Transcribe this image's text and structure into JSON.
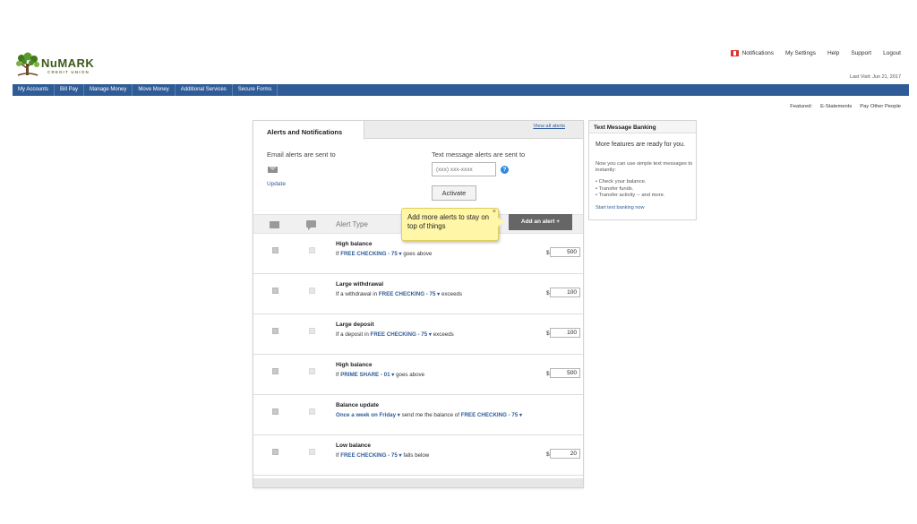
{
  "logo": {
    "name": "NuMARK",
    "subtitle": "CREDIT UNION"
  },
  "top_links": [
    "Notifications",
    "My Settings",
    "Help",
    "Support",
    "Logout"
  ],
  "last_visit": "Last Visit: Jun 21, 2017",
  "nav": [
    "My Accounts",
    "Bill Pay",
    "Manage Money",
    "Move Money",
    "Additional Services",
    "Secure Forms"
  ],
  "featured": {
    "label": "Featured:",
    "items": [
      "E-Statements",
      "Pay Other People"
    ]
  },
  "panel": {
    "tab": "Alerts and Notifications",
    "view_all": "View all alerts",
    "email_label": "Email alerts are sent to",
    "update": "Update",
    "text_label": "Text message alerts are sent to",
    "phone_placeholder": "(xxx) xxx-xxxx",
    "help": "?",
    "activate": "Activate",
    "alert_type_header": "Alert Type",
    "add_alert": "Add an alert  +",
    "tooltip": "Add more alerts to stay on top of things",
    "tooltip_close": "×",
    "currency": "$"
  },
  "alerts": [
    {
      "title": "High balance",
      "pre": "If",
      "account": "FREE CHECKING - 75 ▾",
      "post": "goes above",
      "amount": "500"
    },
    {
      "title": "Large withdrawal",
      "pre": "If a withdrawal in",
      "account": "FREE CHECKING - 75 ▾",
      "post": "exceeds",
      "amount": "100"
    },
    {
      "title": "Large deposit",
      "pre": "If a deposit in",
      "account": "FREE CHECKING - 75 ▾",
      "post": "exceeds",
      "amount": "100"
    },
    {
      "title": "High balance",
      "pre": "If",
      "account": "PRIME SHARE - 01 ▾",
      "post": "goes above",
      "amount": "500"
    },
    {
      "title": "Balance update",
      "pre": "",
      "account": "Once a week on Friday ▾",
      "post": "send me the balance of",
      "account2": "FREE CHECKING - 75 ▾",
      "amount": ""
    },
    {
      "title": "Low balance",
      "pre": "If",
      "account": "FREE CHECKING - 75 ▾",
      "post": "falls below",
      "amount": "20"
    }
  ],
  "side": {
    "title": "Text Message Banking",
    "lead": "More features are ready for you.",
    "text": "Now you can use simple text messages to instantly:",
    "items": [
      "Check your balance.",
      "Transfer funds.",
      "Transfer activity -- and more."
    ],
    "link": "Start text banking now"
  },
  "colors": {
    "nav": "#2f5c97",
    "tooltip": "#fff6a8",
    "logo": "#3d5a1a"
  }
}
